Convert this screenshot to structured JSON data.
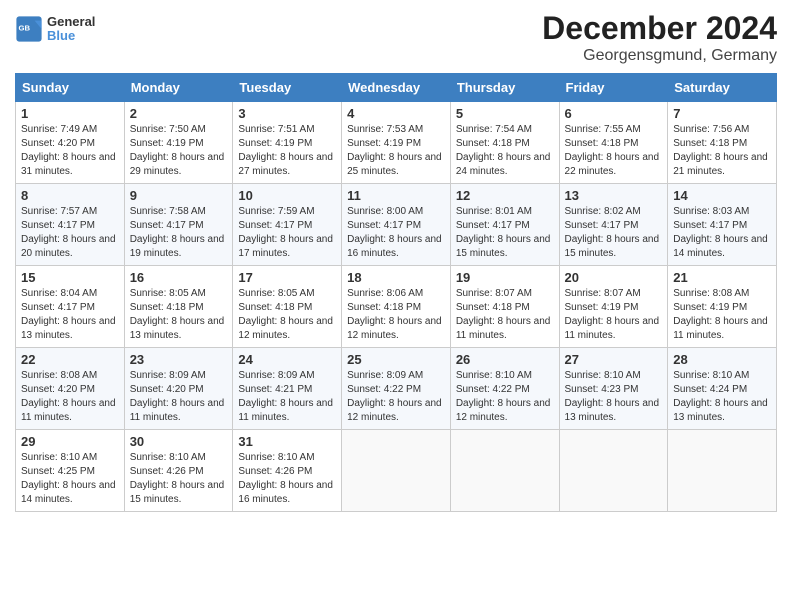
{
  "header": {
    "title": "December 2024",
    "subtitle": "Georgensgmund, Germany",
    "logo_general": "General",
    "logo_blue": "Blue"
  },
  "days_of_week": [
    "Sunday",
    "Monday",
    "Tuesday",
    "Wednesday",
    "Thursday",
    "Friday",
    "Saturday"
  ],
  "weeks": [
    [
      {
        "day": "1",
        "sunrise": "7:49 AM",
        "sunset": "4:20 PM",
        "daylight": "8 hours and 31 minutes."
      },
      {
        "day": "2",
        "sunrise": "7:50 AM",
        "sunset": "4:19 PM",
        "daylight": "8 hours and 29 minutes."
      },
      {
        "day": "3",
        "sunrise": "7:51 AM",
        "sunset": "4:19 PM",
        "daylight": "8 hours and 27 minutes."
      },
      {
        "day": "4",
        "sunrise": "7:53 AM",
        "sunset": "4:19 PM",
        "daylight": "8 hours and 25 minutes."
      },
      {
        "day": "5",
        "sunrise": "7:54 AM",
        "sunset": "4:18 PM",
        "daylight": "8 hours and 24 minutes."
      },
      {
        "day": "6",
        "sunrise": "7:55 AM",
        "sunset": "4:18 PM",
        "daylight": "8 hours and 22 minutes."
      },
      {
        "day": "7",
        "sunrise": "7:56 AM",
        "sunset": "4:18 PM",
        "daylight": "8 hours and 21 minutes."
      }
    ],
    [
      {
        "day": "8",
        "sunrise": "7:57 AM",
        "sunset": "4:17 PM",
        "daylight": "8 hours and 20 minutes."
      },
      {
        "day": "9",
        "sunrise": "7:58 AM",
        "sunset": "4:17 PM",
        "daylight": "8 hours and 19 minutes."
      },
      {
        "day": "10",
        "sunrise": "7:59 AM",
        "sunset": "4:17 PM",
        "daylight": "8 hours and 17 minutes."
      },
      {
        "day": "11",
        "sunrise": "8:00 AM",
        "sunset": "4:17 PM",
        "daylight": "8 hours and 16 minutes."
      },
      {
        "day": "12",
        "sunrise": "8:01 AM",
        "sunset": "4:17 PM",
        "daylight": "8 hours and 15 minutes."
      },
      {
        "day": "13",
        "sunrise": "8:02 AM",
        "sunset": "4:17 PM",
        "daylight": "8 hours and 15 minutes."
      },
      {
        "day": "14",
        "sunrise": "8:03 AM",
        "sunset": "4:17 PM",
        "daylight": "8 hours and 14 minutes."
      }
    ],
    [
      {
        "day": "15",
        "sunrise": "8:04 AM",
        "sunset": "4:17 PM",
        "daylight": "8 hours and 13 minutes."
      },
      {
        "day": "16",
        "sunrise": "8:05 AM",
        "sunset": "4:18 PM",
        "daylight": "8 hours and 13 minutes."
      },
      {
        "day": "17",
        "sunrise": "8:05 AM",
        "sunset": "4:18 PM",
        "daylight": "8 hours and 12 minutes."
      },
      {
        "day": "18",
        "sunrise": "8:06 AM",
        "sunset": "4:18 PM",
        "daylight": "8 hours and 12 minutes."
      },
      {
        "day": "19",
        "sunrise": "8:07 AM",
        "sunset": "4:18 PM",
        "daylight": "8 hours and 11 minutes."
      },
      {
        "day": "20",
        "sunrise": "8:07 AM",
        "sunset": "4:19 PM",
        "daylight": "8 hours and 11 minutes."
      },
      {
        "day": "21",
        "sunrise": "8:08 AM",
        "sunset": "4:19 PM",
        "daylight": "8 hours and 11 minutes."
      }
    ],
    [
      {
        "day": "22",
        "sunrise": "8:08 AM",
        "sunset": "4:20 PM",
        "daylight": "8 hours and 11 minutes."
      },
      {
        "day": "23",
        "sunrise": "8:09 AM",
        "sunset": "4:20 PM",
        "daylight": "8 hours and 11 minutes."
      },
      {
        "day": "24",
        "sunrise": "8:09 AM",
        "sunset": "4:21 PM",
        "daylight": "8 hours and 11 minutes."
      },
      {
        "day": "25",
        "sunrise": "8:09 AM",
        "sunset": "4:22 PM",
        "daylight": "8 hours and 12 minutes."
      },
      {
        "day": "26",
        "sunrise": "8:10 AM",
        "sunset": "4:22 PM",
        "daylight": "8 hours and 12 minutes."
      },
      {
        "day": "27",
        "sunrise": "8:10 AM",
        "sunset": "4:23 PM",
        "daylight": "8 hours and 13 minutes."
      },
      {
        "day": "28",
        "sunrise": "8:10 AM",
        "sunset": "4:24 PM",
        "daylight": "8 hours and 13 minutes."
      }
    ],
    [
      {
        "day": "29",
        "sunrise": "8:10 AM",
        "sunset": "4:25 PM",
        "daylight": "8 hours and 14 minutes."
      },
      {
        "day": "30",
        "sunrise": "8:10 AM",
        "sunset": "4:26 PM",
        "daylight": "8 hours and 15 minutes."
      },
      {
        "day": "31",
        "sunrise": "8:10 AM",
        "sunset": "4:26 PM",
        "daylight": "8 hours and 16 minutes."
      },
      null,
      null,
      null,
      null
    ]
  ],
  "labels": {
    "sunrise": "Sunrise:",
    "sunset": "Sunset:",
    "daylight": "Daylight:"
  }
}
